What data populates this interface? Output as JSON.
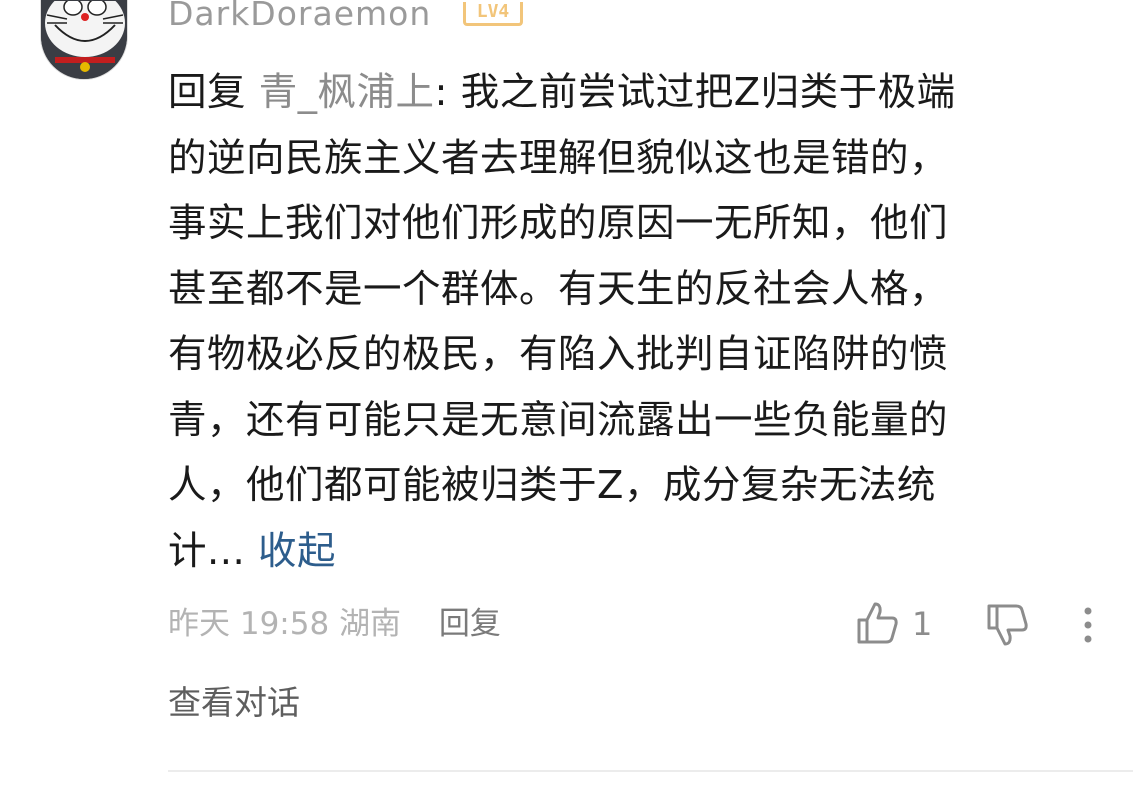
{
  "comment": {
    "username": "DarkDoraemon",
    "level_badge": "LV4",
    "reply_prefix": "回复 ",
    "reply_target": "青_枫浦上",
    "text_lines": [
      ": 我之前尝试过把Z归类于极端",
      "的逆向民族主义者去理解但貌似这也是错的，",
      "事实上我们对他们形成的原因一无所知，他们",
      "甚至都不是一个群体。有天生的反社会人格，",
      "有物极必反的极民，有陷入批判自证陷阱的愤",
      "青，还有可能只是无意间流露出一些负能量的",
      "人，他们都可能被归类于Z，成分复杂无法统",
      "计... "
    ],
    "collapse_label": "收起",
    "timestamp": "昨天 19:58",
    "location": "湖南",
    "reply_label": "回复",
    "like_count": "1",
    "view_conversation_label": "查看对话",
    "icons": {
      "avatar": "doraemon-avatar",
      "like": "thumbs-up-icon",
      "dislike": "thumbs-down-icon",
      "more": "more-vertical-icon"
    },
    "colors": {
      "username": "#9a9a9a",
      "badge": "#f2c57a",
      "link": "#2d5d8c"
    }
  }
}
